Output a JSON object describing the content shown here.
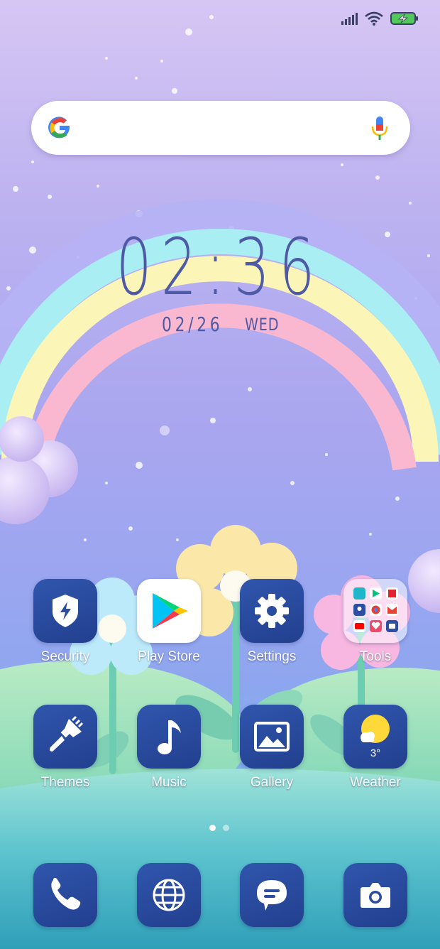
{
  "status_bar": {
    "signal": "signal-icon",
    "wifi": "wifi-icon",
    "battery": "battery-charging-icon"
  },
  "search": {
    "placeholder": "",
    "google_icon": "google-g-icon",
    "mic_icon": "microphone-icon"
  },
  "clock": {
    "time": "02:36",
    "date": "02/26",
    "weekday": "WED"
  },
  "home_apps": [
    {
      "label": "Security",
      "icon": "shield-bolt-icon"
    },
    {
      "label": "Play Store",
      "icon": "play-store-icon"
    },
    {
      "label": "Settings",
      "icon": "gear-icon"
    },
    {
      "label": "Tools",
      "icon": "folder-icon"
    },
    {
      "label": "Themes",
      "icon": "paintbrush-icon"
    },
    {
      "label": "Music",
      "icon": "music-note-icon"
    },
    {
      "label": "Gallery",
      "icon": "image-icon"
    },
    {
      "label": "Weather",
      "icon": "sun-cloud-icon",
      "temperature": "3°"
    }
  ],
  "page_indicator": {
    "current": 1,
    "total": 2
  },
  "dock": [
    {
      "icon": "phone-icon"
    },
    {
      "icon": "globe-icon"
    },
    {
      "icon": "message-icon"
    },
    {
      "icon": "camera-icon"
    }
  ]
}
